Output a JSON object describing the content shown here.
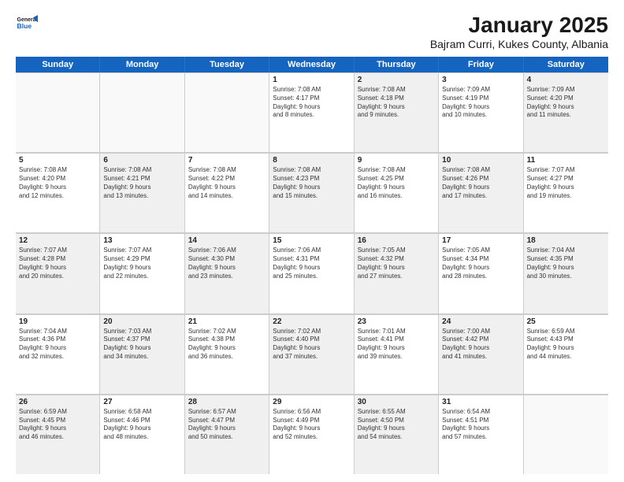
{
  "header": {
    "logo_line1": "General",
    "logo_line2": "Blue",
    "main_title": "January 2025",
    "subtitle": "Bajram Curri, Kukes County, Albania"
  },
  "weekdays": [
    "Sunday",
    "Monday",
    "Tuesday",
    "Wednesday",
    "Thursday",
    "Friday",
    "Saturday"
  ],
  "rows": [
    [
      {
        "day": "",
        "text": "",
        "empty": true
      },
      {
        "day": "",
        "text": "",
        "empty": true
      },
      {
        "day": "",
        "text": "",
        "empty": true
      },
      {
        "day": "1",
        "text": "Sunrise: 7:08 AM\nSunset: 4:17 PM\nDaylight: 9 hours\nand 8 minutes.",
        "shaded": false
      },
      {
        "day": "2",
        "text": "Sunrise: 7:08 AM\nSunset: 4:18 PM\nDaylight: 9 hours\nand 9 minutes.",
        "shaded": true
      },
      {
        "day": "3",
        "text": "Sunrise: 7:09 AM\nSunset: 4:19 PM\nDaylight: 9 hours\nand 10 minutes.",
        "shaded": false
      },
      {
        "day": "4",
        "text": "Sunrise: 7:09 AM\nSunset: 4:20 PM\nDaylight: 9 hours\nand 11 minutes.",
        "shaded": true
      }
    ],
    [
      {
        "day": "5",
        "text": "Sunrise: 7:08 AM\nSunset: 4:20 PM\nDaylight: 9 hours\nand 12 minutes.",
        "shaded": false
      },
      {
        "day": "6",
        "text": "Sunrise: 7:08 AM\nSunset: 4:21 PM\nDaylight: 9 hours\nand 13 minutes.",
        "shaded": true
      },
      {
        "day": "7",
        "text": "Sunrise: 7:08 AM\nSunset: 4:22 PM\nDaylight: 9 hours\nand 14 minutes.",
        "shaded": false
      },
      {
        "day": "8",
        "text": "Sunrise: 7:08 AM\nSunset: 4:23 PM\nDaylight: 9 hours\nand 15 minutes.",
        "shaded": true
      },
      {
        "day": "9",
        "text": "Sunrise: 7:08 AM\nSunset: 4:25 PM\nDaylight: 9 hours\nand 16 minutes.",
        "shaded": false
      },
      {
        "day": "10",
        "text": "Sunrise: 7:08 AM\nSunset: 4:26 PM\nDaylight: 9 hours\nand 17 minutes.",
        "shaded": true
      },
      {
        "day": "11",
        "text": "Sunrise: 7:07 AM\nSunset: 4:27 PM\nDaylight: 9 hours\nand 19 minutes.",
        "shaded": false
      }
    ],
    [
      {
        "day": "12",
        "text": "Sunrise: 7:07 AM\nSunset: 4:28 PM\nDaylight: 9 hours\nand 20 minutes.",
        "shaded": true
      },
      {
        "day": "13",
        "text": "Sunrise: 7:07 AM\nSunset: 4:29 PM\nDaylight: 9 hours\nand 22 minutes.",
        "shaded": false
      },
      {
        "day": "14",
        "text": "Sunrise: 7:06 AM\nSunset: 4:30 PM\nDaylight: 9 hours\nand 23 minutes.",
        "shaded": true
      },
      {
        "day": "15",
        "text": "Sunrise: 7:06 AM\nSunset: 4:31 PM\nDaylight: 9 hours\nand 25 minutes.",
        "shaded": false
      },
      {
        "day": "16",
        "text": "Sunrise: 7:05 AM\nSunset: 4:32 PM\nDaylight: 9 hours\nand 27 minutes.",
        "shaded": true
      },
      {
        "day": "17",
        "text": "Sunrise: 7:05 AM\nSunset: 4:34 PM\nDaylight: 9 hours\nand 28 minutes.",
        "shaded": false
      },
      {
        "day": "18",
        "text": "Sunrise: 7:04 AM\nSunset: 4:35 PM\nDaylight: 9 hours\nand 30 minutes.",
        "shaded": true
      }
    ],
    [
      {
        "day": "19",
        "text": "Sunrise: 7:04 AM\nSunset: 4:36 PM\nDaylight: 9 hours\nand 32 minutes.",
        "shaded": false
      },
      {
        "day": "20",
        "text": "Sunrise: 7:03 AM\nSunset: 4:37 PM\nDaylight: 9 hours\nand 34 minutes.",
        "shaded": true
      },
      {
        "day": "21",
        "text": "Sunrise: 7:02 AM\nSunset: 4:38 PM\nDaylight: 9 hours\nand 36 minutes.",
        "shaded": false
      },
      {
        "day": "22",
        "text": "Sunrise: 7:02 AM\nSunset: 4:40 PM\nDaylight: 9 hours\nand 37 minutes.",
        "shaded": true
      },
      {
        "day": "23",
        "text": "Sunrise: 7:01 AM\nSunset: 4:41 PM\nDaylight: 9 hours\nand 39 minutes.",
        "shaded": false
      },
      {
        "day": "24",
        "text": "Sunrise: 7:00 AM\nSunset: 4:42 PM\nDaylight: 9 hours\nand 41 minutes.",
        "shaded": true
      },
      {
        "day": "25",
        "text": "Sunrise: 6:59 AM\nSunset: 4:43 PM\nDaylight: 9 hours\nand 44 minutes.",
        "shaded": false
      }
    ],
    [
      {
        "day": "26",
        "text": "Sunrise: 6:59 AM\nSunset: 4:45 PM\nDaylight: 9 hours\nand 46 minutes.",
        "shaded": true
      },
      {
        "day": "27",
        "text": "Sunrise: 6:58 AM\nSunset: 4:46 PM\nDaylight: 9 hours\nand 48 minutes.",
        "shaded": false
      },
      {
        "day": "28",
        "text": "Sunrise: 6:57 AM\nSunset: 4:47 PM\nDaylight: 9 hours\nand 50 minutes.",
        "shaded": true
      },
      {
        "day": "29",
        "text": "Sunrise: 6:56 AM\nSunset: 4:49 PM\nDaylight: 9 hours\nand 52 minutes.",
        "shaded": false
      },
      {
        "day": "30",
        "text": "Sunrise: 6:55 AM\nSunset: 4:50 PM\nDaylight: 9 hours\nand 54 minutes.",
        "shaded": true
      },
      {
        "day": "31",
        "text": "Sunrise: 6:54 AM\nSunset: 4:51 PM\nDaylight: 9 hours\nand 57 minutes.",
        "shaded": false
      },
      {
        "day": "",
        "text": "",
        "empty": true
      }
    ]
  ]
}
